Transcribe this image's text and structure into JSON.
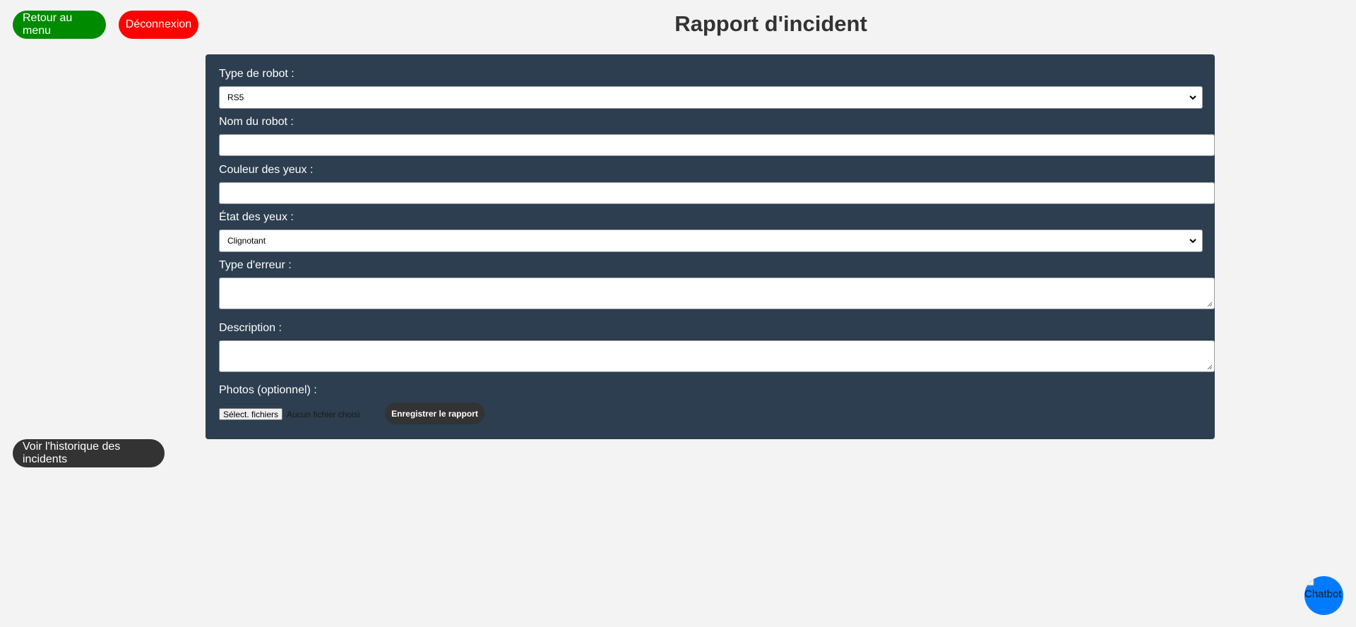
{
  "header": {
    "menu_button": "Retour au menu",
    "logout_button": "Déconnexion",
    "title": "Rapport d'incident"
  },
  "form": {
    "robot_type": {
      "label": "Type de robot :",
      "value": "RS5"
    },
    "robot_name": {
      "label": "Nom du robot :",
      "value": ""
    },
    "eye_color": {
      "label": "Couleur des yeux :",
      "value": ""
    },
    "eye_state": {
      "label": "État des yeux :",
      "value": "Clignotant"
    },
    "error_type": {
      "label": "Type d'erreur :",
      "value": ""
    },
    "description": {
      "label": "Description :",
      "value": ""
    },
    "photos": {
      "label": "Photos (optionnel) :",
      "file_button": "Sélect. fichiers",
      "file_status": "Aucun fichier choisi"
    },
    "submit_button": "Enregistrer le rapport"
  },
  "history_button": "Voir l'historique des incidents",
  "chatbot": {
    "alt_text": "Chatbot",
    "icon": "broken-image-icon"
  },
  "colors": {
    "background": "#f3f3f3",
    "panel": "#2c3e50",
    "menu_button": "#008a00",
    "logout_button": "#ff0000",
    "dark_button": "#333333",
    "chatbot": "#007bff"
  }
}
